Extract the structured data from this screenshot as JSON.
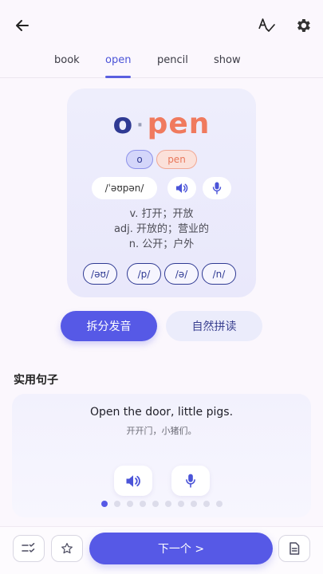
{
  "nav": {
    "back_icon": "arrow-left-icon",
    "spell_icon": "spellcheck-icon",
    "settings_icon": "gear-icon"
  },
  "tabs": [
    {
      "label": "book",
      "active": false
    },
    {
      "label": "open",
      "active": true
    },
    {
      "label": "pencil",
      "active": false
    },
    {
      "label": "show",
      "active": false
    }
  ],
  "word_card": {
    "syllable_1": "o",
    "separator": "·",
    "syllable_2": "pen",
    "syllable_chips": [
      "o",
      "pen"
    ],
    "phonetic": "/ˈəʊpən/",
    "meanings": [
      "v. 打开；开放",
      "adj. 开放的；营业的",
      "n. 公开；户外"
    ],
    "phonemes": [
      "/əʊ/",
      "/p/",
      "/ə/",
      "/n/"
    ]
  },
  "modes": {
    "split_label": "拆分发音",
    "phonics_label": "自然拼读",
    "active": "split"
  },
  "sentences": {
    "title": "实用句子",
    "english": "Open the door, little pigs.",
    "chinese": "开开门，小猪们。",
    "page_count": 10,
    "current_page": 1
  },
  "bottom": {
    "next_label": "下一个 >"
  },
  "colors": {
    "accent": "#5659e6",
    "syllable_1": "#2f3a93",
    "syllable_2": "#f07a5e"
  }
}
